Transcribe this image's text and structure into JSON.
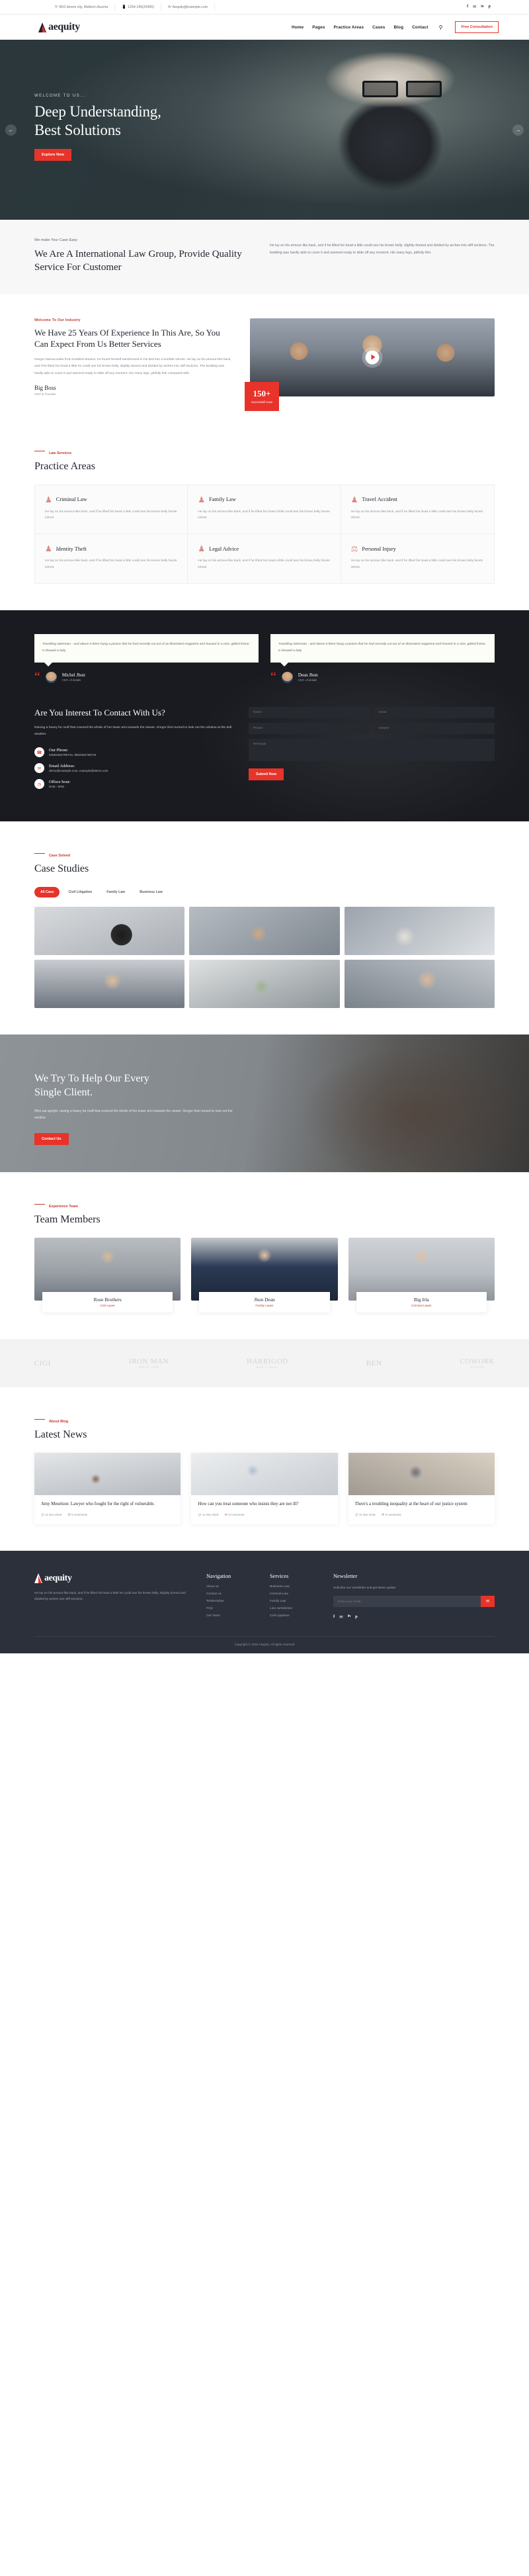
{
  "topbar": {
    "address": "45/3 dreem city, Melborn Ausrria",
    "phone": "1254-145(25455)",
    "email": "Aequity@example.com",
    "socials": [
      "f",
      "t",
      "in",
      "p"
    ]
  },
  "header": {
    "brand": "aequity",
    "nav": [
      {
        "label": "Home"
      },
      {
        "label": "Pages"
      },
      {
        "label": "Practice Areas"
      },
      {
        "label": "Cases"
      },
      {
        "label": "Blog"
      },
      {
        "label": "Contact"
      }
    ],
    "search_icon": "search-icon",
    "cta": "Free Consultation"
  },
  "hero": {
    "eyebrow": "WELCOME TO US...",
    "title_line1": "Deep Understanding,",
    "title_line2": "Best Solutions",
    "cta": "Explore Now",
    "prev": "←",
    "next": "→"
  },
  "about_band": {
    "eyebrow": "We make Your Case Easy",
    "title": "We Are A International Law Group, Provide Quality Service For Customer",
    "body": "He lay on his armour-like back, and if he lifted his head a little could see his brown belly, slightly domed and divided by arches into stiff sections. The bedding was hardly able to cover it and seemed ready to slide off any moment. His many legs, pitifully thin."
  },
  "experience": {
    "eyebrow": "Welcome To Our Industry",
    "title": "We Have 25 Years Of Experience In This Are, So You Can Expect From Us Better Services",
    "body": "Gregor Samsa woke from troubled dreams, he found himself transformed in his bed into a horrible vermin. He lay on his armour-like back, and if he lifted his head a little he could see his brown belly, slightly domed and divided by arches into stiff sections. The bedding was hardly able to cover it and seemed ready to slide off any moment. His many legs, pitifully thin compared with.",
    "signature": "Big Boss",
    "signature_role": "CEO & Founder",
    "badge_number": "150+",
    "badge_label": "Successfull Case",
    "play_icon": "play-icon"
  },
  "practice": {
    "eyebrow": "Law Services",
    "title": "Practice Areas",
    "items": [
      {
        "icon": "judge-icon",
        "glyph": "♟",
        "name": "Criminal Law",
        "text": "He lay on his armour-like back, and if he lifted his head a little could see his brown belly facets inhreit"
      },
      {
        "icon": "family-icon",
        "glyph": "♟",
        "name": "Family Law",
        "text": "He lay on his armour-like back, and if he lifted his head a little could see his brown belly facets inhreit"
      },
      {
        "icon": "accident-icon",
        "glyph": "♟",
        "name": "Travel Accident",
        "text": "He lay on his armour-like back, and if he lifted his head a little could see his brown belly facets inhreit."
      },
      {
        "icon": "identity-icon",
        "glyph": "♟",
        "name": "Identity Theft",
        "text": "He lay on his armour-like back, and if he lifted his head a little could see his brown belly facets inhreit."
      },
      {
        "icon": "advice-icon",
        "glyph": "♟",
        "name": "Legal Advice",
        "text": "He lay on his armour-like back, and if he lifted his head a little could see his brown belly facets inhreit"
      },
      {
        "icon": "scales-icon",
        "glyph": "⚖",
        "name": "Personal Injury",
        "text": "He lay on his armour-like back, and if he lifted his head a little could see his brown belly facets inhreit."
      }
    ]
  },
  "testimonials": [
    {
      "quote": "Travelling salesman - and above it there hung a picture that he had recently cut out of an illustrated magazine and housed in a nice, gilded frame. It showed a lady",
      "name": "Michel Jhon",
      "role": "CEO. of details",
      "quote_mark": "“"
    },
    {
      "quote": "Travelling salesman - and above it there hung a picture that he had recently cut out of an illustrated magazine and housed in a nice, gilded frame. It showed a lady",
      "name": "Dean Jhon",
      "role": "CEO. of details",
      "quote_mark": "“"
    }
  ],
  "contact": {
    "title": "Are You Interest To Contact With Us?",
    "body": "Raising a heavy fur muff that covered the whole of her lower arm towards the viewer. Gregor then turned to look out the window at the dull weather.",
    "items": [
      {
        "icon": "phone-icon",
        "glyph": "✆",
        "label": "Our Phone:",
        "value": "54562364769744, 8562364769744"
      },
      {
        "icon": "envelope-icon",
        "glyph": "✉",
        "label": "Email Address:",
        "value": "demo@example.com, example@demo.com"
      },
      {
        "icon": "clock-icon",
        "glyph": "◴",
        "label": "Offuce hour:",
        "value": "9AM - 5PM"
      }
    ],
    "form": {
      "name_placeholder": "Name",
      "email_placeholder": "Email",
      "phone_placeholder": "Phone",
      "subject_placeholder": "Subject",
      "message_placeholder": "Message",
      "submit": "Submit Now"
    }
  },
  "cases": {
    "eyebrow": "Case Solved",
    "title": "Case Studies",
    "filters": [
      {
        "label": "All Case",
        "active": true
      },
      {
        "label": "Civil Litigation",
        "active": false
      },
      {
        "label": "Family Law",
        "active": false
      },
      {
        "label": "Business Law",
        "active": false
      }
    ],
    "images": [
      "gavel-photo",
      "money-handoff-photo",
      "laptop-desk-photo",
      "woman-sitting-photo",
      "cash-photo",
      "woman-glasses-photo"
    ]
  },
  "help": {
    "title_line1": "We Try To Help Our Every",
    "title_line2": "Single Client.",
    "body": "Who sat upright, raising a heavy fur muff that covered the whole of her lower arm towards the viewer. Gregor then turned to look out the window",
    "cta": "Contact Us"
  },
  "team": {
    "eyebrow": "Experience Team",
    "title": "Team Members",
    "members": [
      {
        "name": "Rose Brothers",
        "role": "Civil Lawer",
        "photo": "member-photo-1"
      },
      {
        "name": "Jhon Dean",
        "role": "Family Lawer",
        "photo": "member-photo-2"
      },
      {
        "name": "Big Irla",
        "role": "Criminal Lawer",
        "photo": "member-photo-3"
      }
    ]
  },
  "brands": [
    {
      "name": "CIGI",
      "sub": ""
    },
    {
      "name": "IRON MAN",
      "sub": "SINCE 1948"
    },
    {
      "name": "HARRIGOD",
      "sub": "Ring it Right"
    },
    {
      "name": "BEN",
      "sub": ""
    },
    {
      "name": "COWORK",
      "sub": "STUDIO"
    }
  ],
  "news": {
    "eyebrow": "About Blog",
    "title": "Latest News",
    "posts": [
      {
        "title": "Amy Meselson: Lawyer who fought for the right of vulnerable.",
        "date": "11 Nov 2018",
        "comments": "5 comments",
        "photo": "office-women-photo"
      },
      {
        "title": "How can you treat someone who insists they are not ill?",
        "date": "11 Nov 2018",
        "comments": "5 comments",
        "photo": "man-tablet-photo"
      },
      {
        "title": "There's a troubling inequality at the heart of our justice system",
        "date": "11 Nov 2018",
        "comments": "5 comments",
        "photo": "worried-man-photo"
      }
    ]
  },
  "footer": {
    "brand": "aequity",
    "about": "He lay on his armour-like back, and if he lifted his head a little he could see his brown belly, slightly domed and divided by arches into stiff sections.",
    "nav_heading": "Navigation",
    "nav_links": [
      "About us",
      "Contact us",
      "Testimonilas",
      "FAQ",
      "Our Team"
    ],
    "services_heading": "Services",
    "services_links": [
      "Business Law",
      "Criminal Law",
      "Family Law",
      "Law Jurisdiction",
      "Civil Ligations"
    ],
    "newsletter_heading": "Newsletter",
    "newsletter_text": "Subcribe our newsletter and get latest update",
    "newsletter_placeholder": "Enter your email",
    "newsletter_button": "✉",
    "socials": [
      "f",
      "t",
      "in",
      "p"
    ],
    "copyright_pre": "Copyright © 2019 Aequity. All rights reserved"
  }
}
